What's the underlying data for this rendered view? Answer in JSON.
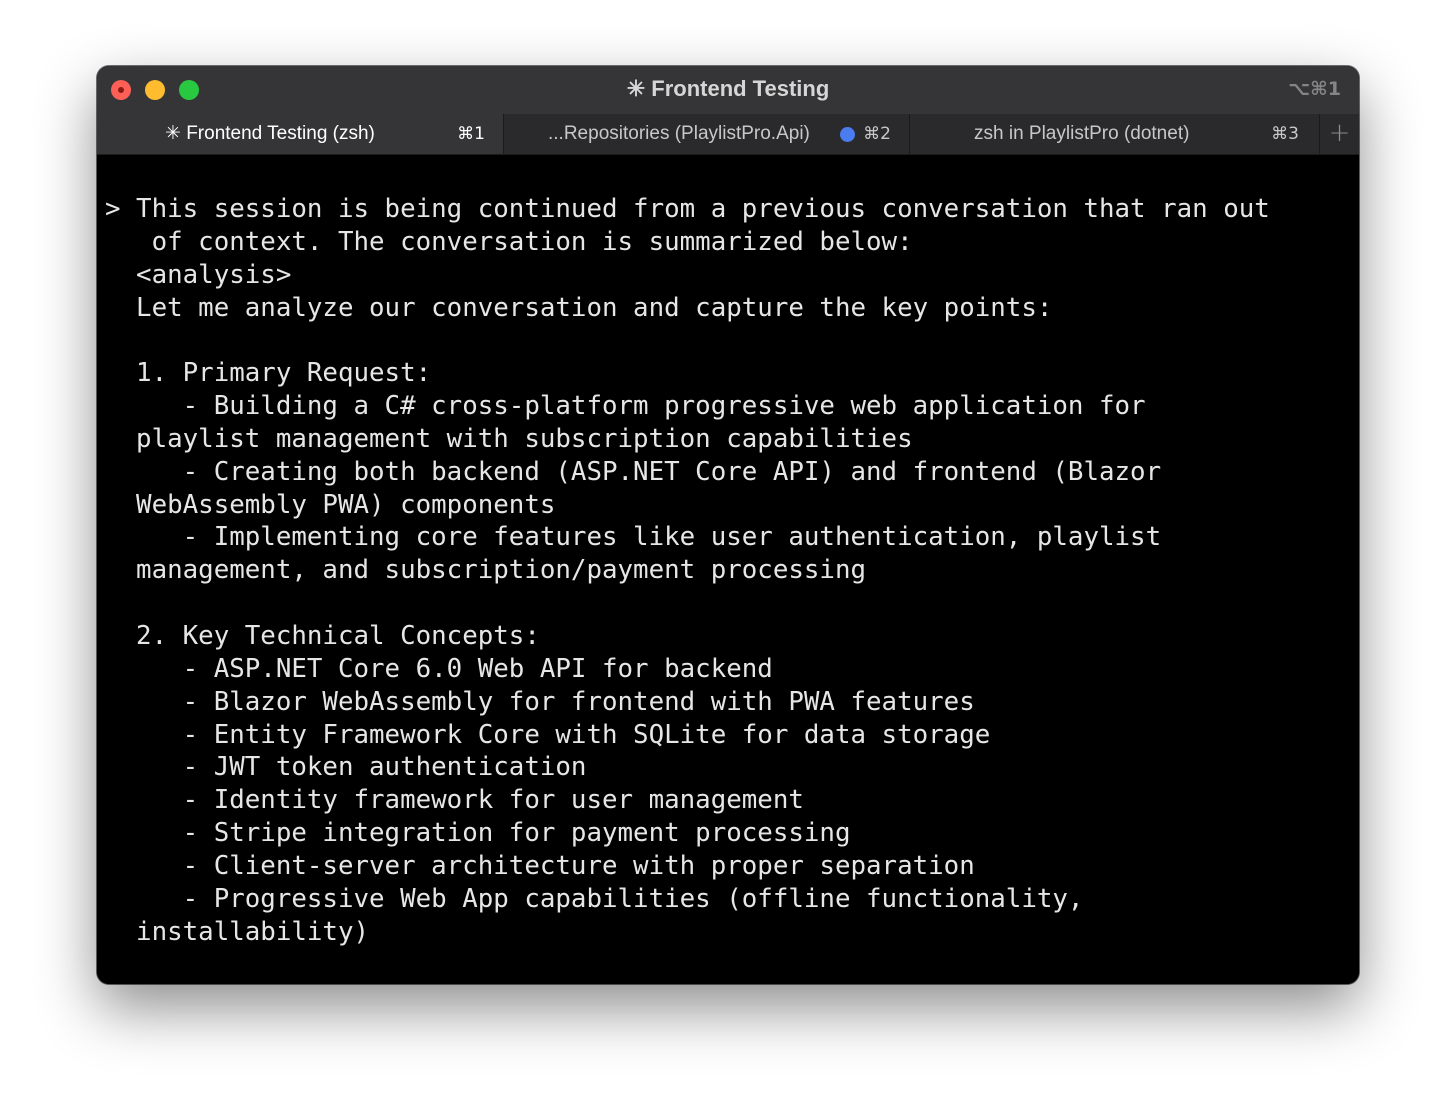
{
  "window": {
    "title": "✳ Frontend Testing",
    "shortcut": "⌥⌘1"
  },
  "tabs": [
    {
      "label": "✳ Frontend Testing (zsh)",
      "shortcut": "⌘1",
      "active": true
    },
    {
      "label": "...Repositories (PlaylistPro.Api)",
      "shortcut": "⌘2",
      "active": false,
      "activity_dot_color": "#4a7cf0"
    },
    {
      "label": "zsh in PlaylistPro (dotnet)",
      "shortcut": "⌘3",
      "active": false
    }
  ],
  "new_tab_label": "+",
  "terminal": {
    "lines": [
      "> This session is being continued from a previous conversation that ran out",
      "   of context. The conversation is summarized below:",
      "  <analysis>",
      "  Let me analyze our conversation and capture the key points:",
      "",
      "  1. Primary Request:",
      "     - Building a C# cross-platform progressive web application for",
      "  playlist management with subscription capabilities",
      "     - Creating both backend (ASP.NET Core API) and frontend (Blazor",
      "  WebAssembly PWA) components",
      "     - Implementing core features like user authentication, playlist",
      "  management, and subscription/payment processing",
      "",
      "  2. Key Technical Concepts:",
      "     - ASP.NET Core 6.0 Web API for backend",
      "     - Blazor WebAssembly for frontend with PWA features",
      "     - Entity Framework Core with SQLite for data storage",
      "     - JWT token authentication",
      "     - Identity framework for user management",
      "     - Stripe integration for payment processing",
      "     - Client-server architecture with proper separation",
      "     - Progressive Web App capabilities (offline functionality,",
      "  installability)"
    ]
  }
}
